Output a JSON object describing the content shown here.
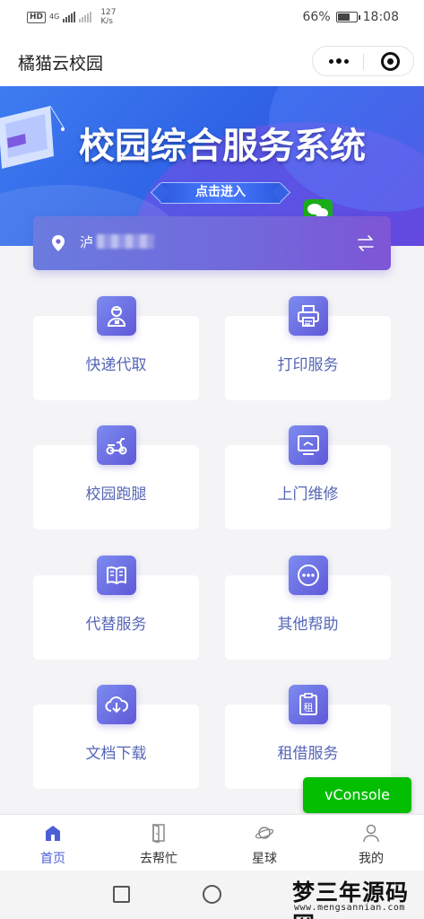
{
  "status_bar": {
    "hd_label": "HD",
    "network_type": "4G",
    "speed_value": "127",
    "speed_unit": "K/s",
    "battery_percent": "66%",
    "battery_level": 0.66,
    "time": "18:08"
  },
  "nav_bar": {
    "title": "橘猫云校园",
    "more_icon": "more-dots-icon",
    "close_icon": "target-close-icon"
  },
  "banner": {
    "title": "校园综合服务系统",
    "button_label": "点击进入"
  },
  "location": {
    "name_visible": "泸",
    "pin_icon": "location-pin-icon",
    "switch_icon": "swap-arrows-icon"
  },
  "services": [
    {
      "label": "快递代取",
      "icon": "courier-icon"
    },
    {
      "label": "打印服务",
      "icon": "printer-icon"
    },
    {
      "label": "校园跑腿",
      "icon": "scooter-icon"
    },
    {
      "label": "上门维修",
      "icon": "monitor-repair-icon"
    },
    {
      "label": "代替服务",
      "icon": "book-icon"
    },
    {
      "label": "其他帮助",
      "icon": "more-circle-icon"
    },
    {
      "label": "文档下载",
      "icon": "cloud-download-icon"
    },
    {
      "label": "租借服务",
      "icon": "rent-clipboard-icon"
    }
  ],
  "vconsole": {
    "label": "vConsole"
  },
  "tab_bar": {
    "items": [
      {
        "label": "首页",
        "icon": "home-icon",
        "active": true
      },
      {
        "label": "去帮忙",
        "icon": "door-icon",
        "active": false
      },
      {
        "label": "星球",
        "icon": "planet-icon",
        "active": false
      },
      {
        "label": "我的",
        "icon": "user-icon",
        "active": false
      }
    ]
  },
  "watermark": {
    "title": "梦三年源码网",
    "url": "www.mengsannian.com"
  },
  "colors": {
    "accent": "#6058d8",
    "active_tab": "#4a5fd6",
    "vconsole": "#04be02",
    "banner": "#2f64e6"
  }
}
